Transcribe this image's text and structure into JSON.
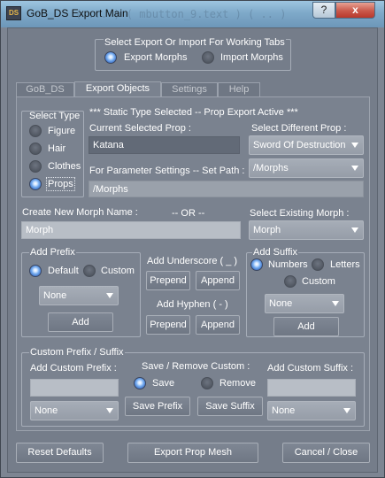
{
  "window": {
    "title": "GoB_DS Export Main",
    "icon_text": "DS",
    "ghost_text": "( ... ) ( mbutton_9.text ) ( .. )",
    "help_label": "?",
    "close_label": "x"
  },
  "mode": {
    "heading": "Select Export Or Import For Working Tabs",
    "export_label": "Export Morphs",
    "import_label": "Import Morphs",
    "selected": "export"
  },
  "tabs": [
    "GoB_DS",
    "Export Objects",
    "Settings",
    "Help"
  ],
  "active_tab": "Export Objects",
  "select_type": {
    "heading": "Select Type",
    "options": [
      "Figure",
      "Hair",
      "Clothes",
      "Props"
    ],
    "selected": "Props"
  },
  "status_line": "***   Static Type Selected -- Prop Export Active   ***",
  "current_prop": {
    "label": "Current Selected Prop :",
    "value": "Katana"
  },
  "different_prop": {
    "label": "Select Different Prop :",
    "value": "Sword Of Destruction"
  },
  "param_path": {
    "label": "For Parameter Settings -- Set Path :",
    "combo_value": "/Morphs",
    "field_value": "/Morphs"
  },
  "morph_name": {
    "label": "Create New Morph Name :",
    "or_text": "-- OR --",
    "value": "Morph"
  },
  "existing_morph": {
    "label": "Select Existing Morph :",
    "value": "Morph"
  },
  "add_prefix": {
    "heading": "Add Prefix",
    "default_label": "Default",
    "custom_label": "Custom",
    "selected": "default",
    "combo_value": "None",
    "add_label": "Add"
  },
  "underscore": {
    "heading": "Add Underscore ( _ )",
    "prepend": "Prepend",
    "append": "Append"
  },
  "hyphen": {
    "heading": "Add Hyphen  ( - )",
    "prepend": "Prepend",
    "append": "Append"
  },
  "add_suffix": {
    "heading": "Add Suffix",
    "numbers_label": "Numbers",
    "letters_label": "Letters",
    "custom_label": "Custom",
    "selected": "numbers",
    "combo_value": "None",
    "add_label": "Add"
  },
  "custom_ps": {
    "heading": "Custom Prefix / Suffix",
    "prefix_label": "Add Custom Prefix :",
    "prefix_value": "",
    "prefix_combo": "None",
    "save_remove_label": "Save / Remove Custom :",
    "save_label": "Save",
    "remove_label": "Remove",
    "selected": "save",
    "save_prefix": "Save Prefix",
    "save_suffix": "Save Suffix",
    "suffix_label": "Add Custom Suffix :",
    "suffix_value": "",
    "suffix_combo": "None"
  },
  "footer": {
    "reset": "Reset Defaults",
    "export": "Export Prop Mesh",
    "cancel": "Cancel / Close"
  },
  "colors": {
    "radio_selected": "#3b6ec4",
    "close_button": "#c9584a"
  }
}
